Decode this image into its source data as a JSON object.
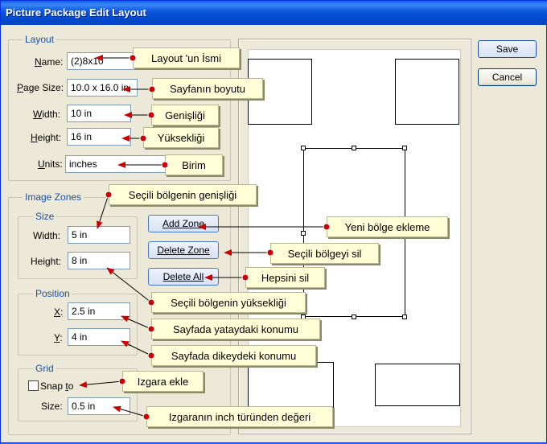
{
  "window": {
    "title": "Picture Package Edit Layout"
  },
  "layout": {
    "legend": "Layout",
    "name_label_prefix": "N",
    "name_label_rest": "ame:",
    "name_value": "(2)8x10",
    "page_size_label_prefix": "P",
    "page_size_label_rest": "age Size:",
    "page_size_value": "10.0 x 16.0 in",
    "width_label_prefix": "W",
    "width_label_rest": "idth:",
    "width_value": "10 in",
    "height_label_prefix": "H",
    "height_label_rest": "eight:",
    "height_value": "16 in",
    "units_label_prefix": "U",
    "units_label_rest": "nits:",
    "units_value": "inches"
  },
  "image_zones": {
    "legend": "Image Zones",
    "size_legend": "Size",
    "width_label": "Width:",
    "width_value": "5 in",
    "height_label": "Height:",
    "height_value": "8 in",
    "position_legend": "Position",
    "x_label_prefix": "X",
    "x_label_rest": ":",
    "x_value": "2.5 in",
    "y_label_prefix": "Y",
    "y_label_rest": ":",
    "y_value": "4 in",
    "grid_legend": "Grid",
    "snap_label_pre": "Snap ",
    "snap_label_t": "t",
    "snap_label_post": "o",
    "grid_size_label": "Size:",
    "grid_size_value": "0.5 in"
  },
  "buttons": {
    "add_zone": "Add Zone",
    "delete_zone": "Delete Zone",
    "delete_all": "Delete All",
    "save": "Save",
    "cancel": "Cancel"
  },
  "callouts": {
    "layout_name": "Layout 'un İsmi",
    "page_size": "Sayfanın boyutu",
    "width": "Genişliği",
    "height": "Yüksekliği",
    "units": "Birim",
    "zone_width": "Seçili bölgenin genişliği",
    "add_zone": "Yeni bölge ekleme",
    "delete_zone": "Seçili bölgeyi sil",
    "delete_all": "Hepsini sil",
    "zone_height": "Seçili bölgenin yüksekliği",
    "x_pos": "Sayfada yataydaki konumu",
    "y_pos": "Sayfada dikeydeki konumu",
    "snap": "Izgara ekle",
    "grid_size": "Izgaranın inch türünden değeri"
  },
  "colors": {
    "arrow": "#cc0000",
    "legend": "#1e50a0",
    "callout_bg": "#ffffd8"
  }
}
